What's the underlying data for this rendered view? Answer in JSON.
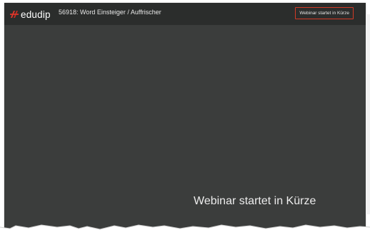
{
  "header": {
    "brand": "edudip",
    "title": "56918: Word Einsteiger / Auffrischer",
    "status_badge": "Webinar startet in Kürze"
  },
  "stage": {
    "message": "Webinar startet in Kürze"
  },
  "colors": {
    "background": "#3b3d3c",
    "topbar": "#2b2d2c",
    "accent": "#d23a26",
    "text": "#ececec"
  },
  "icons": {
    "logo": "edudip-logo-icon"
  }
}
